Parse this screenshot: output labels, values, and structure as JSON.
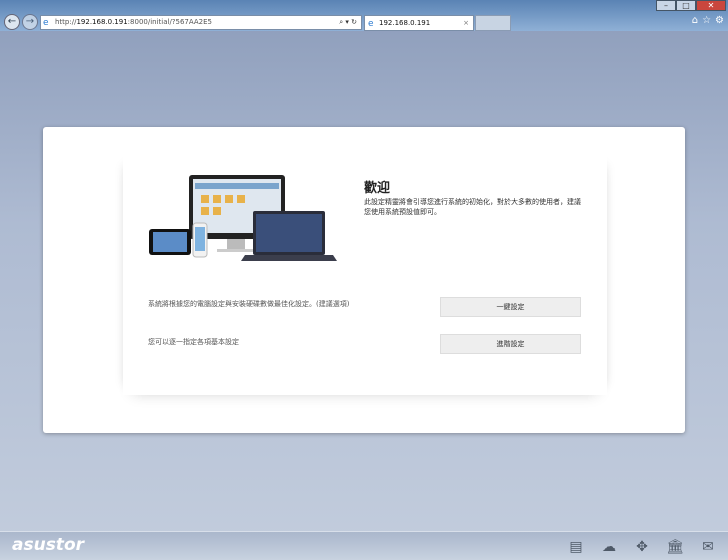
{
  "browser": {
    "url_prefix": "http://",
    "url_host": "192.168.0.191",
    "url_rest": ":8000/initial/?567AA2E5",
    "tab_title": "192.168.0.191"
  },
  "welcome": {
    "title": "歡迎",
    "description": "此設定精靈將會引導您進行系統的初始化，對於大多數的使用者，建議您使用系統預設值即可。"
  },
  "options": [
    {
      "text": "系統將根據您的電腦設定與安裝硬碟數做最佳化設定。(建議選項)",
      "button": "一鍵設定"
    },
    {
      "text": "您可以逐一指定各項基本設定",
      "button": "進階設定"
    }
  ],
  "footer": {
    "logo": "asustor"
  }
}
